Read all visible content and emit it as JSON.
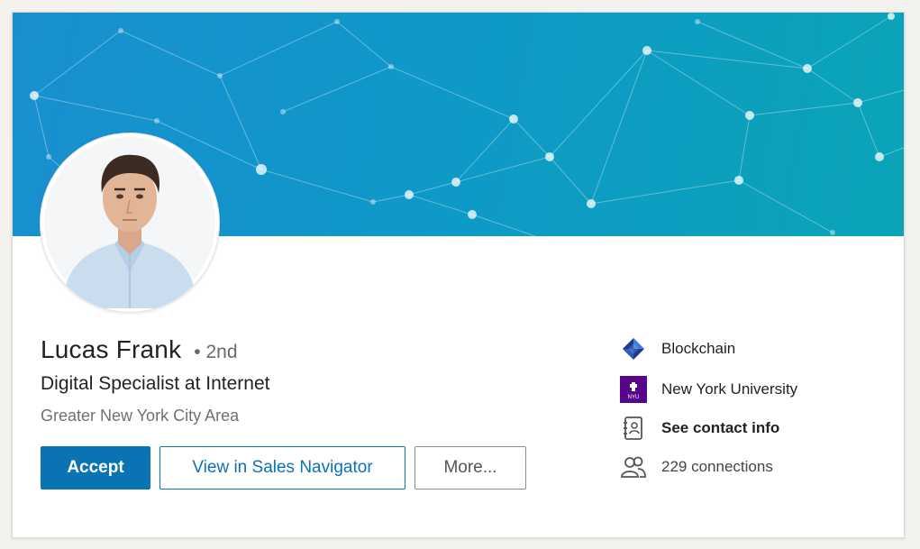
{
  "profile": {
    "name": "Lucas Frank",
    "degree": "• 2nd",
    "headline": "Digital Specialist at Internet",
    "location": "Greater New York City Area"
  },
  "actions": {
    "accept_label": "Accept",
    "sales_navigator_label": "View in Sales Navigator",
    "more_label": "More..."
  },
  "sidebar": {
    "items": [
      {
        "label": "Blockchain",
        "icon": "blockchain-logo-icon"
      },
      {
        "label": "New York University",
        "icon": "nyu-logo-icon",
        "logo_text": "NYU"
      },
      {
        "label": "See contact info",
        "icon": "contact-card-icon"
      },
      {
        "label": "229 connections",
        "icon": "people-icon"
      }
    ]
  },
  "colors": {
    "primary": "#0a73b4",
    "banner_start": "#1a8fd0",
    "banner_end": "#0aa4b8",
    "nyu_purple": "#57068c",
    "blockchain_blue": "#1b3a8c"
  }
}
